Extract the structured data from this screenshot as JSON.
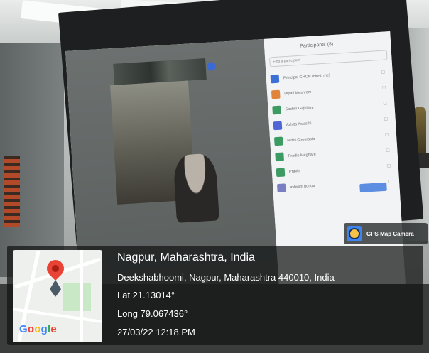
{
  "zoom": {
    "panel_title": "Participants (8)",
    "search_placeholder": "Find a participant",
    "participants": [
      {
        "name": "Principal GHCN (Host, me)",
        "color": "#3b6fd6"
      },
      {
        "name": "Dipali Meshram",
        "color": "#e0843c"
      },
      {
        "name": "Sachin Gajbhiye",
        "color": "#3c9a63"
      },
      {
        "name": "Ashita Awasthi",
        "color": "#5066d4"
      },
      {
        "name": "Nidhi Chourasia",
        "color": "#3c9a63"
      },
      {
        "name": "Pradip Meghare",
        "color": "#3c9a63"
      },
      {
        "name": "Pravin",
        "color": "#3c9a63"
      },
      {
        "name": "ashwini borkar",
        "color": "#7a7fc2"
      }
    ]
  },
  "gps": {
    "app_name": "GPS Map Camera",
    "location_title": "Nagpur, Maharashtra, India",
    "address": "Deekshabhoomi, Nagpur, Maharashtra 440010, India",
    "lat": "Lat 21.13014°",
    "long": "Long 79.067436°",
    "datetime": "27/03/22 12:18 PM",
    "map_brand": "Google",
    "brand_colors": [
      "#4285F4",
      "#EA4335",
      "#FBBC05",
      "#4285F4",
      "#34A853",
      "#EA4335"
    ]
  }
}
